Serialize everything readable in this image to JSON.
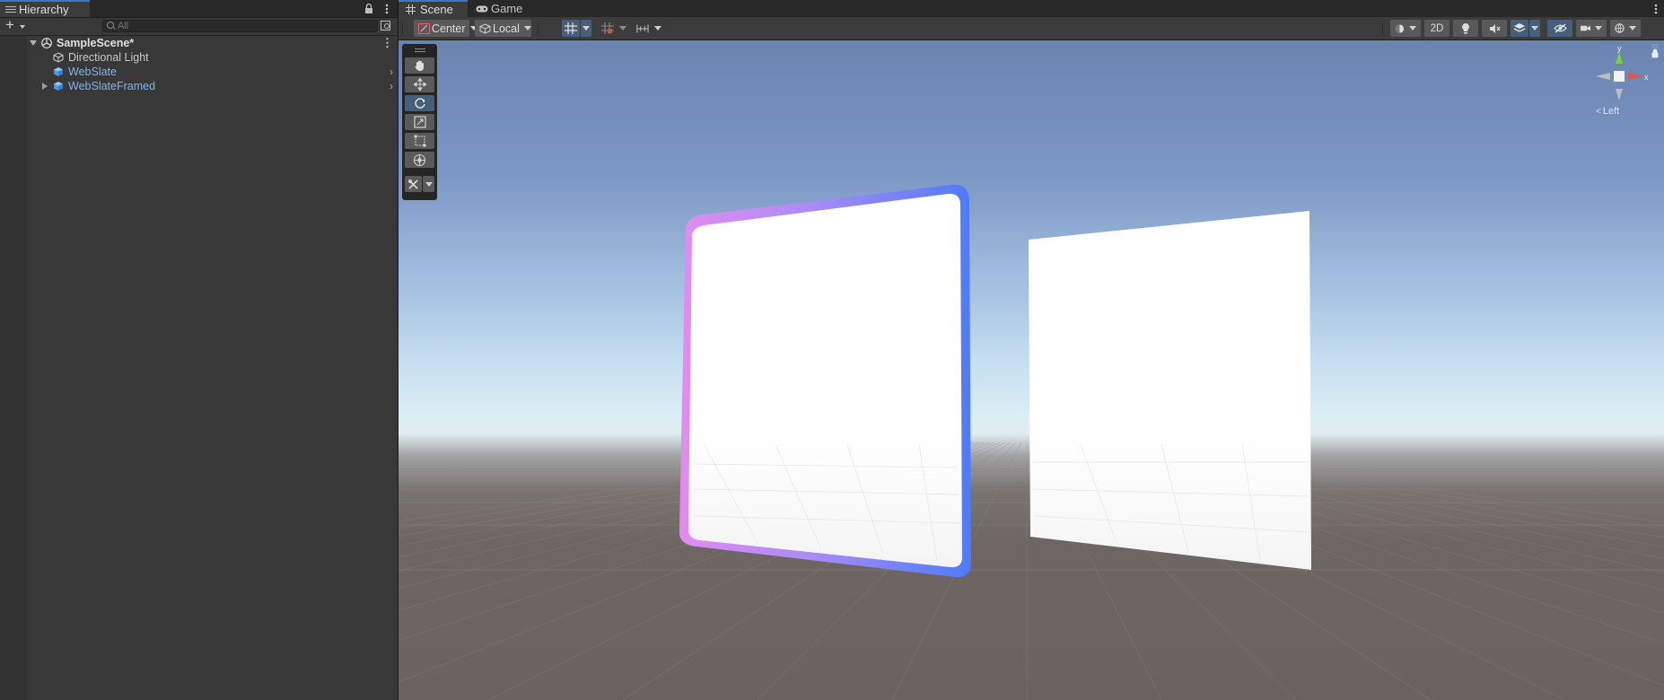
{
  "hierarchy": {
    "tab_label": "Hierarchy",
    "search_placeholder": "All",
    "items": [
      {
        "label": "SampleScene*",
        "kind": "scene"
      },
      {
        "label": "Directional Light",
        "kind": "object"
      },
      {
        "label": "WebSlate",
        "kind": "prefab"
      },
      {
        "label": "WebSlateFramed",
        "kind": "prefab"
      }
    ]
  },
  "scene_view": {
    "tabs": [
      {
        "label": "Scene",
        "icon": "grid-icon",
        "active": true
      },
      {
        "label": "Game",
        "icon": "gamepad-icon",
        "active": false
      }
    ],
    "pivot_mode": "Center",
    "pivot_rotation": "Local",
    "view_2d_label": "2D",
    "orientation_label": "Left",
    "axis_labels": {
      "y": "y",
      "x": "x"
    }
  },
  "colors": {
    "selection_accent": "#3a79bb",
    "prefab_text": "#7cb4f4",
    "toggle_on": "#46607c",
    "frame_gradient_start": "#e38cf0",
    "frame_gradient_end": "#4f7bf6"
  }
}
